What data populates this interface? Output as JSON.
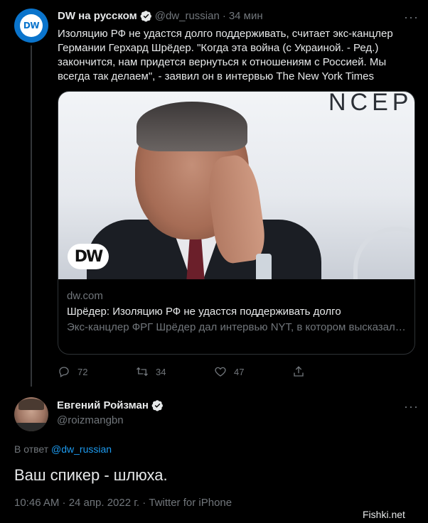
{
  "tweet": {
    "author_name": "DW на русском",
    "author_handle": "@dw_russian",
    "separator": "·",
    "time": "34 мин",
    "more": "···",
    "avatar_text": "DW",
    "text": "Изоляцию РФ не удастся долго поддерживать, считает экс-канцлер Германии Герхард Шрёдер. \"Когда эта война (с Украиной. - Ред.) закончится, нам придется вернуться к отношениям с Россией. Мы всегда так делаем\", - заявил он в интервью The New York Times",
    "card": {
      "logo_text": "DW",
      "wall_text": "NCEPT",
      "domain": "dw.com",
      "title": "Шрёдер: Изоляцию РФ не удастся поддерживать долго",
      "description": "Экс-канцлер ФРГ Шрёдер дал интервью NYT, в котором высказал мнение об изоляции Москвы и сообщил, когда уйдет с поста главы…"
    },
    "actions": {
      "replies": "72",
      "retweets": "34",
      "likes": "47"
    }
  },
  "reply": {
    "author_name": "Евгений Ройзман",
    "author_handle": "@roizmangbn",
    "more": "···",
    "reply_prefix": "В ответ",
    "reply_to": "@dw_russian",
    "text": "Ваш спикер - шлюха.",
    "meta": "10:46 AM · 24 апр. 2022 г. · Twitter for iPhone"
  },
  "watermark": "Fishki.net",
  "colors": {
    "background": "#000000",
    "text": "#e7e9ea",
    "muted": "#71767b",
    "accent": "#1d9bf0",
    "dw_blue": "#0a74cc"
  },
  "icons": [
    "verified-icon",
    "reply-icon",
    "retweet-icon",
    "like-icon",
    "share-icon",
    "more-icon"
  ]
}
